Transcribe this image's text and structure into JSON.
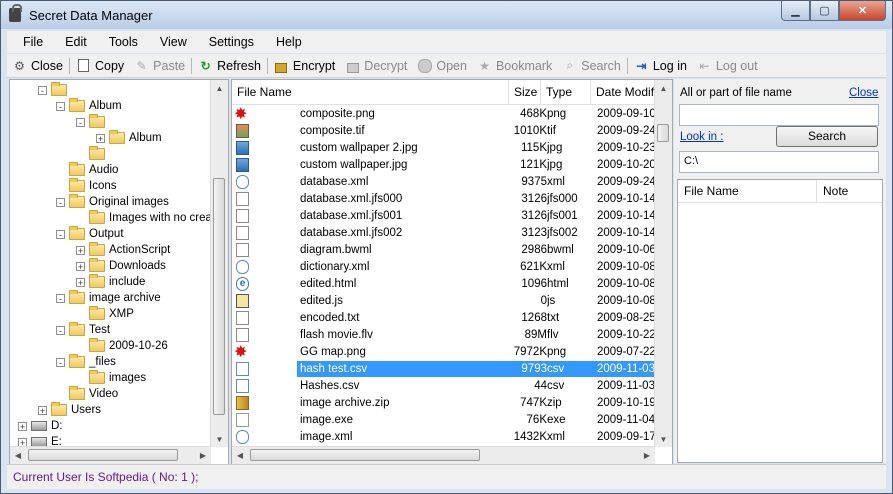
{
  "window": {
    "title": "Secret Data Manager"
  },
  "menu": [
    "File",
    "Edit",
    "Tools",
    "View",
    "Settings",
    "Help"
  ],
  "toolbar": [
    {
      "label": "Close",
      "icon": "gear-icon",
      "enabled": true
    },
    {
      "label": "Copy",
      "icon": "copy-icon",
      "enabled": true
    },
    {
      "label": "Paste",
      "icon": "paste-icon",
      "enabled": false
    },
    {
      "label": "Refresh",
      "icon": "refresh-icon",
      "enabled": true
    },
    {
      "label": "Encrypt",
      "icon": "lock-icon",
      "enabled": true
    },
    {
      "label": "Decrypt",
      "icon": "unlock-icon",
      "enabled": false
    },
    {
      "label": "Open",
      "icon": "open-icon",
      "enabled": false
    },
    {
      "label": "Bookmark",
      "icon": "star-icon",
      "enabled": false
    },
    {
      "label": "Search",
      "icon": "search-icon",
      "enabled": false
    },
    {
      "label": "Log in",
      "icon": "login-icon",
      "enabled": true
    },
    {
      "label": "Log out",
      "icon": "logout-icon",
      "enabled": false
    }
  ],
  "tree": [
    {
      "label": "",
      "level": 2,
      "expander": "-"
    },
    {
      "label": "Album",
      "level": 3,
      "expander": "-"
    },
    {
      "label": "",
      "level": 4,
      "expander": "-"
    },
    {
      "label": "Album",
      "level": 5,
      "expander": "+"
    },
    {
      "label": "",
      "level": 4,
      "expander": ""
    },
    {
      "label": "Audio",
      "level": 3,
      "expander": ""
    },
    {
      "label": "Icons",
      "level": 3,
      "expander": ""
    },
    {
      "label": "Original images",
      "level": 3,
      "expander": "-"
    },
    {
      "label": "Images with no creat",
      "level": 4,
      "expander": ""
    },
    {
      "label": "Output",
      "level": 3,
      "expander": "-"
    },
    {
      "label": "ActionScript",
      "level": 4,
      "expander": "+"
    },
    {
      "label": "Downloads",
      "level": 4,
      "expander": "+"
    },
    {
      "label": "include",
      "level": 4,
      "expander": "+"
    },
    {
      "label": "image archive",
      "level": 3,
      "expander": "-"
    },
    {
      "label": "XMP",
      "level": 4,
      "expander": ""
    },
    {
      "label": "Test",
      "level": 3,
      "expander": "-"
    },
    {
      "label": "2009-10-26",
      "level": 4,
      "expander": ""
    },
    {
      "label": "_files",
      "level": 3,
      "expander": "-"
    },
    {
      "label": "images",
      "level": 4,
      "expander": ""
    },
    {
      "label": "Video",
      "level": 3,
      "expander": ""
    },
    {
      "label": "Users",
      "level": 2,
      "expander": "+"
    },
    {
      "label": "D:",
      "level": 1,
      "expander": "+",
      "drive": true
    },
    {
      "label": "E:",
      "level": 1,
      "expander": "+",
      "drive": true
    }
  ],
  "filelist": {
    "columns": [
      "File Name",
      "Size",
      "Type",
      "Date Modifie"
    ],
    "rows": [
      {
        "name": "composite.png",
        "size": "468K",
        "type": "png",
        "date": "2009-09-10",
        "icon": "splat"
      },
      {
        "name": "composite.tif",
        "size": "1010K",
        "type": "tif",
        "date": "2009-09-24",
        "icon": "tif"
      },
      {
        "name": "custom wallpaper 2.jpg",
        "size": "115K",
        "type": "jpg",
        "date": "2009-10-23",
        "icon": "img"
      },
      {
        "name": "custom wallpaper.jpg",
        "size": "121K",
        "type": "jpg",
        "date": "2009-10-20",
        "icon": "img"
      },
      {
        "name": "database.xml",
        "size": "9375",
        "type": "xml",
        "date": "2009-09-24",
        "icon": "xml"
      },
      {
        "name": "database.xml.jfs000",
        "size": "3126",
        "type": "jfs000",
        "date": "2009-10-14",
        "icon": "doc"
      },
      {
        "name": "database.xml.jfs001",
        "size": "3126",
        "type": "jfs001",
        "date": "2009-10-14",
        "icon": "doc"
      },
      {
        "name": "database.xml.jfs002",
        "size": "3123",
        "type": "jfs002",
        "date": "2009-10-14",
        "icon": "doc"
      },
      {
        "name": "diagram.bwml",
        "size": "2986",
        "type": "bwml",
        "date": "2009-10-06",
        "icon": "doc"
      },
      {
        "name": "dictionary.xml",
        "size": "621K",
        "type": "xml",
        "date": "2009-10-08",
        "icon": "xml"
      },
      {
        "name": "edited.html",
        "size": "1096",
        "type": "html",
        "date": "2009-10-08",
        "icon": "html"
      },
      {
        "name": "edited.js",
        "size": "0",
        "type": "js",
        "date": "2009-10-08",
        "icon": "js"
      },
      {
        "name": "encoded.txt",
        "size": "1268",
        "type": "txt",
        "date": "2009-08-25",
        "icon": "doc"
      },
      {
        "name": "flash movie.flv",
        "size": "89M",
        "type": "flv",
        "date": "2009-10-22",
        "icon": "doc"
      },
      {
        "name": "GG map.png",
        "size": "7972K",
        "type": "png",
        "date": "2009-07-22",
        "icon": "splat"
      },
      {
        "name": "hash test.csv",
        "size": "9793",
        "type": "csv",
        "date": "2009-11-03",
        "icon": "csv",
        "selected": true
      },
      {
        "name": "Hashes.csv",
        "size": "44",
        "type": "csv",
        "date": "2009-11-03",
        "icon": "csv"
      },
      {
        "name": "image archive.zip",
        "size": "747K",
        "type": "zip",
        "date": "2009-10-19",
        "icon": "zip"
      },
      {
        "name": "image.exe",
        "size": "76K",
        "type": "exe",
        "date": "2009-11-04",
        "icon": "exe"
      },
      {
        "name": "image.xml",
        "size": "1432K",
        "type": "xml",
        "date": "2009-09-17",
        "icon": "xml"
      }
    ]
  },
  "search_panel": {
    "name_label": "All or part of file name",
    "close_label": "Close",
    "name_value": "",
    "look_in_label": "Look in :",
    "search_button": "Search",
    "look_in_value": "C:\\",
    "columns": [
      "File Name",
      "Note"
    ]
  },
  "status": {
    "text": "Current User Is Softpedia ( No: 1 );"
  }
}
